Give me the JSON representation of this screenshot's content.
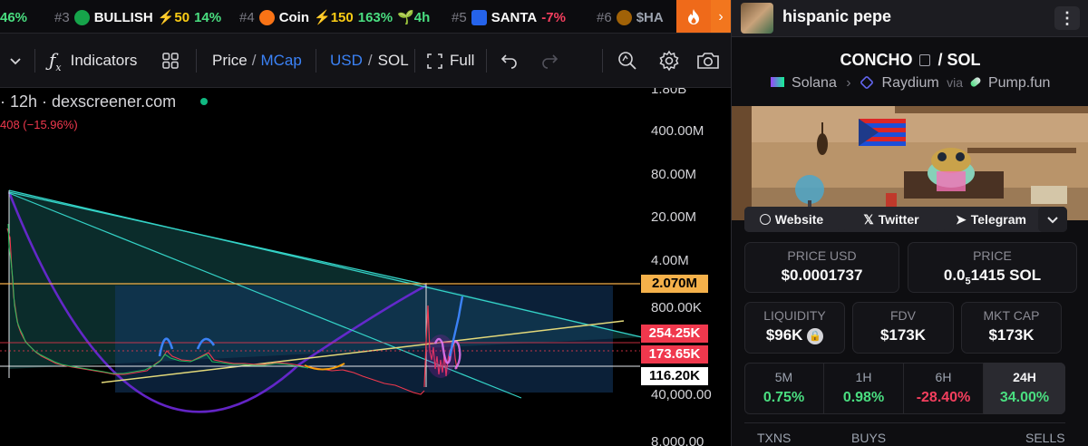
{
  "ticker": [
    {
      "rank": "",
      "name": "",
      "boost": "",
      "change": "46%",
      "change_dir": "up",
      "extra": ""
    },
    {
      "rank": "#3",
      "name": "BULLISH",
      "boost": "⚡50",
      "change": "14%",
      "change_dir": "up",
      "extra": ""
    },
    {
      "rank": "#4",
      "name": "Coin",
      "boost": "⚡150",
      "change": "163%",
      "change_dir": "up",
      "extra": "4h"
    },
    {
      "rank": "#5",
      "name": "SANTA",
      "boost": "",
      "change": "-7%",
      "change_dir": "down",
      "extra": ""
    },
    {
      "rank": "#6",
      "name": "$HA",
      "boost": "",
      "change": "",
      "change_dir": "",
      "extra": ""
    }
  ],
  "toolbar": {
    "indicators": "Indicators",
    "price": "Price",
    "slash": "/",
    "mcap": "MCap",
    "usd": "USD",
    "sol": "SOL",
    "full": "Full"
  },
  "chart": {
    "legend_title": "· 12h · dexscreener.com",
    "legend_change": "408 (−15.96%)",
    "axis_labels": [
      "1.80B",
      "400.00M",
      "80.00M",
      "20.00M",
      "4.00M",
      "800.00K",
      "40,000.00",
      "8,000.00"
    ],
    "price_labels": {
      "resistance": "2.070M",
      "upper": "254.25K",
      "mid": "173.65K",
      "current": "116.20K"
    },
    "colors": {
      "resistance": "#f5b14a",
      "upper": "#f0384d",
      "mid": "#f0384d",
      "current": "#ffffff"
    }
  },
  "token": {
    "name": "hispanic pepe",
    "pair": "CONCHO",
    "quote": "SOL",
    "chain": "Solana",
    "dex": "Raydium",
    "via": "via",
    "launchpad": "Pump.fun",
    "links": {
      "website": "Website",
      "twitter": "Twitter",
      "telegram": "Telegram"
    }
  },
  "stats": {
    "price_usd_label": "PRICE USD",
    "price_usd": "$0.0001737",
    "price_label": "PRICE",
    "price_sol_prefix": "0.0",
    "price_sol_sub": "5",
    "price_sol_suffix": "1415 SOL",
    "liquidity_label": "LIQUIDITY",
    "liquidity": "$96K",
    "fdv_label": "FDV",
    "fdv": "$173K",
    "mcap_label": "MKT CAP",
    "mcap": "$173K"
  },
  "timeframes": [
    {
      "label": "5M",
      "value": "0.75%",
      "dir": "up"
    },
    {
      "label": "1H",
      "value": "0.98%",
      "dir": "up"
    },
    {
      "label": "6H",
      "value": "-28.40%",
      "dir": "down"
    },
    {
      "label": "24H",
      "value": "34.00%",
      "dir": "up"
    }
  ],
  "txns": {
    "txns_label": "TXNS",
    "buys_label": "BUYS",
    "sells_label": "SELLS"
  }
}
